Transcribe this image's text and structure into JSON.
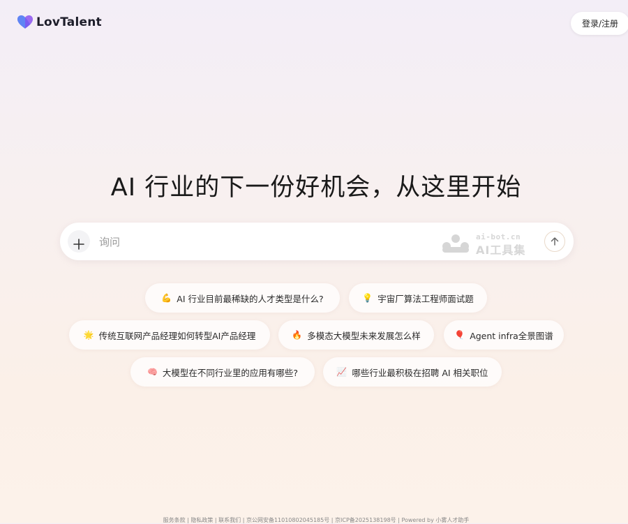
{
  "header": {
    "brand_name": "LovTalent",
    "brand_color": "#7357e8",
    "login_label": "登录/注册"
  },
  "hero": {
    "headline": "AI 行业的下一份好机会，从这里开始"
  },
  "search": {
    "placeholder": "询问",
    "value": "",
    "watermark_top": "ai-bot.cn",
    "watermark_bottom": "AI工具集"
  },
  "suggestions": [
    {
      "icon": "💪",
      "icon_name": "flexed-biceps-icon",
      "label": "AI 行业目前最稀缺的人才类型是什么?"
    },
    {
      "icon": "💡",
      "icon_name": "lightbulb-icon",
      "label": "宇宙厂算法工程师面试题"
    },
    {
      "icon": "🌟",
      "icon_name": "sun-icon",
      "label": "传统互联网产品经理如何转型AI产品经理"
    },
    {
      "icon": "🔥",
      "icon_name": "fire-icon",
      "label": "多模态大模型未来发展怎么样"
    },
    {
      "icon": "🎈",
      "icon_name": "balloon-icon",
      "label": "Agent infra全景图谱"
    },
    {
      "icon": "🧠",
      "icon_name": "brain-icon",
      "label": "大模型在不同行业里的应用有哪些?"
    },
    {
      "icon": "📈",
      "icon_name": "chart-increasing-icon",
      "label": "哪些行业最积极在招聘 AI 相关职位"
    }
  ],
  "footer": {
    "links": [
      "服务条款",
      "隐私政策",
      "联系我们",
      "京公网安备11010802045185号",
      "京ICP备2025138198号",
      "Powered by 小雾人才助手"
    ],
    "separator": " | "
  }
}
